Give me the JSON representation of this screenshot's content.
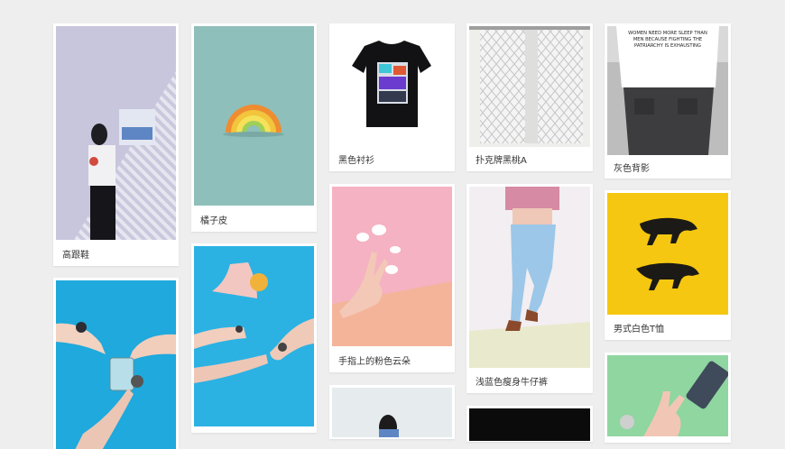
{
  "gallery": {
    "items": [
      {
        "title": "高跟鞋",
        "image": "woman-striped-wall"
      },
      {
        "title": "橘子皮",
        "image": "rainbow-peel"
      },
      {
        "title": "黑色衬衫",
        "image": "black-tshirt"
      },
      {
        "title": "扑克牌黑桃A",
        "image": "patterned-curtains"
      },
      {
        "title": "灰色背影",
        "image": "jeans-back-slogan"
      },
      {
        "title": "手指上的粉色云朵",
        "image": "hand-clouds"
      },
      {
        "title": "浅蓝色瘦身牛仔裤",
        "image": "light-blue-jeans"
      },
      {
        "title": "男式白色T恤",
        "image": "panther-print"
      },
      {
        "title": "",
        "image": "hands-rings-blue"
      },
      {
        "title": "",
        "image": "hands-drink-blue"
      },
      {
        "title": "",
        "image": "woman-portrait"
      },
      {
        "title": "",
        "image": "dark-photo"
      },
      {
        "title": "",
        "image": "hand-bottle-green"
      }
    ],
    "slogan": "WOMEN NEED MORE SLEEP THAN MEN BECAUSE FIGHTING THE PATRIARCHY IS EXHAUSTING"
  }
}
